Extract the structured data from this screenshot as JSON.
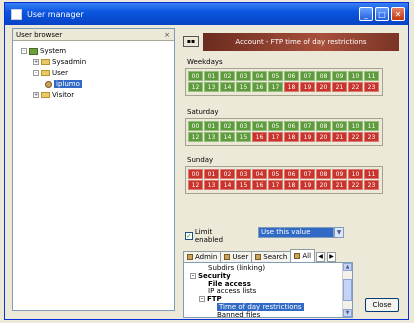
{
  "window": {
    "title": "User manager",
    "colors": {
      "titlebar": "#0a56e0",
      "header_banner": "#a8503c",
      "allowed": "#5e9b3c",
      "denied": "#c8342c"
    }
  },
  "tree": {
    "header": "User browser",
    "close_glyph": "×",
    "nodes": [
      {
        "label": "System",
        "icon": "system-icon",
        "expander": "-"
      },
      {
        "label": "Sysadmin",
        "icon": "folder-icon",
        "expander": "+"
      },
      {
        "label": "User",
        "icon": "folder-icon",
        "expander": "-"
      },
      {
        "label": "iplumo",
        "icon": "user-icon",
        "expander": ""
      },
      {
        "label": "Visitor",
        "icon": "folder-icon",
        "expander": "+"
      }
    ]
  },
  "header": {
    "title": "Account - FTP time of day restrictions",
    "button_glyph": "▪▪"
  },
  "groups": [
    {
      "label": "Weekdays",
      "hours": [
        {
          "label": "00",
          "allowed": true
        },
        {
          "label": "01",
          "allowed": true
        },
        {
          "label": "02",
          "allowed": true
        },
        {
          "label": "03",
          "allowed": true
        },
        {
          "label": "04",
          "allowed": true
        },
        {
          "label": "05",
          "allowed": true
        },
        {
          "label": "06",
          "allowed": true
        },
        {
          "label": "07",
          "allowed": true
        },
        {
          "label": "08",
          "allowed": true
        },
        {
          "label": "09",
          "allowed": true
        },
        {
          "label": "10",
          "allowed": true
        },
        {
          "label": "11",
          "allowed": true
        },
        {
          "label": "12",
          "allowed": true
        },
        {
          "label": "13",
          "allowed": true
        },
        {
          "label": "14",
          "allowed": true
        },
        {
          "label": "15",
          "allowed": true
        },
        {
          "label": "16",
          "allowed": true
        },
        {
          "label": "17",
          "allowed": true
        },
        {
          "label": "18",
          "allowed": false
        },
        {
          "label": "19",
          "allowed": false
        },
        {
          "label": "20",
          "allowed": false
        },
        {
          "label": "21",
          "allowed": false
        },
        {
          "label": "22",
          "allowed": false
        },
        {
          "label": "23",
          "allowed": false
        }
      ]
    },
    {
      "label": "Saturday",
      "hours": [
        {
          "label": "00",
          "allowed": true
        },
        {
          "label": "01",
          "allowed": true
        },
        {
          "label": "02",
          "allowed": true
        },
        {
          "label": "03",
          "allowed": true
        },
        {
          "label": "04",
          "allowed": true
        },
        {
          "label": "05",
          "allowed": true
        },
        {
          "label": "06",
          "allowed": true
        },
        {
          "label": "07",
          "allowed": true
        },
        {
          "label": "08",
          "allowed": true
        },
        {
          "label": "09",
          "allowed": true
        },
        {
          "label": "10",
          "allowed": true
        },
        {
          "label": "11",
          "allowed": true
        },
        {
          "label": "12",
          "allowed": true
        },
        {
          "label": "13",
          "allowed": true
        },
        {
          "label": "14",
          "allowed": true
        },
        {
          "label": "15",
          "allowed": true
        },
        {
          "label": "16",
          "allowed": false
        },
        {
          "label": "17",
          "allowed": false
        },
        {
          "label": "18",
          "allowed": false
        },
        {
          "label": "19",
          "allowed": false
        },
        {
          "label": "20",
          "allowed": false
        },
        {
          "label": "21",
          "allowed": false
        },
        {
          "label": "22",
          "allowed": false
        },
        {
          "label": "23",
          "allowed": false
        }
      ]
    },
    {
      "label": "Sunday",
      "hours": [
        {
          "label": "00",
          "allowed": false
        },
        {
          "label": "01",
          "allowed": false
        },
        {
          "label": "02",
          "allowed": false
        },
        {
          "label": "03",
          "allowed": false
        },
        {
          "label": "04",
          "allowed": false
        },
        {
          "label": "05",
          "allowed": false
        },
        {
          "label": "06",
          "allowed": false
        },
        {
          "label": "07",
          "allowed": false
        },
        {
          "label": "08",
          "allowed": false
        },
        {
          "label": "09",
          "allowed": false
        },
        {
          "label": "10",
          "allowed": false
        },
        {
          "label": "11",
          "allowed": false
        },
        {
          "label": "12",
          "allowed": false
        },
        {
          "label": "13",
          "allowed": false
        },
        {
          "label": "14",
          "allowed": false
        },
        {
          "label": "15",
          "allowed": false
        },
        {
          "label": "16",
          "allowed": false
        },
        {
          "label": "17",
          "allowed": false
        },
        {
          "label": "18",
          "allowed": false
        },
        {
          "label": "19",
          "allowed": false
        },
        {
          "label": "20",
          "allowed": false
        },
        {
          "label": "21",
          "allowed": false
        },
        {
          "label": "22",
          "allowed": false
        },
        {
          "label": "23",
          "allowed": false
        }
      ]
    }
  ],
  "limit": {
    "label": "Limit enabled",
    "checked": true,
    "check_glyph": "✓",
    "select_value": "Use this value",
    "select_arrow": "▼"
  },
  "tabs": [
    {
      "label": "Admin",
      "icon": "admin-icon"
    },
    {
      "label": "User",
      "icon": "user-icon"
    },
    {
      "label": "Search",
      "icon": "search-icon"
    },
    {
      "label": "All",
      "icon": "all-icon",
      "active": true
    }
  ],
  "tab_arrows": {
    "prev": "◀",
    "next": "▶"
  },
  "settings_list": [
    {
      "label": "Subdirs (linking)",
      "indent": 2,
      "bold": false,
      "expander": ""
    },
    {
      "label": "Security",
      "indent": 0,
      "bold": true,
      "expander": "-"
    },
    {
      "label": "File access",
      "indent": 2,
      "bold": true,
      "expander": ""
    },
    {
      "label": "IP access lists",
      "indent": 2,
      "bold": false,
      "expander": ""
    },
    {
      "label": "FTP",
      "indent": 1,
      "bold": true,
      "expander": "-"
    },
    {
      "label": "Time of day restrictions",
      "indent": 3,
      "bold": false,
      "expander": "",
      "selected": true
    },
    {
      "label": "Banned files",
      "indent": 3,
      "bold": false,
      "expander": ""
    }
  ],
  "scrollbar": {
    "up": "▲",
    "down": "▼"
  },
  "close_button": "Close"
}
